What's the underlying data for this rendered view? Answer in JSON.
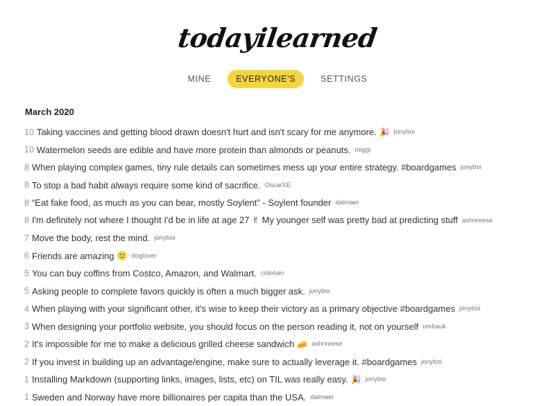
{
  "header": {
    "logo_text": "todayilearned"
  },
  "nav": {
    "tabs": [
      {
        "label": "MINE",
        "active": false
      },
      {
        "label": "EVERYONE'S",
        "active": true
      },
      {
        "label": "SETTINGS",
        "active": false
      }
    ]
  },
  "feed": {
    "month": "March 2020",
    "items": [
      {
        "count": "10",
        "text": "Taking vaccines and getting blood drawn doesn't hurt and isn't scary for me anymore.",
        "emoji": "🎉",
        "user": "jonyboi"
      },
      {
        "count": "10",
        "text": "Watermelon seeds are edible and have more protein than almonds or peanuts.",
        "emoji": "",
        "user": "miggi"
      },
      {
        "count": "8",
        "text": "When playing complex games, tiny rule details can sometimes mess up your entire strategy. #boardgames",
        "emoji": "",
        "user": "jonyboi"
      },
      {
        "count": "8",
        "text": "To stop a bad habit always require some kind of sacrifice.",
        "emoji": "",
        "user": "OscarSE"
      },
      {
        "count": "8",
        "text": "“Eat fake food, as much as you can bear, mostly Soylent” - Soylent founder",
        "emoji": "",
        "user": "dalmaer"
      },
      {
        "count": "8",
        "text": "I'm definitely not where I thought I'd be in life at age 27 ✌ My younger self was pretty bad at predicting stuff",
        "emoji": "",
        "user": "ashnreese"
      },
      {
        "count": "7",
        "text": "Move the body, rest the mind.",
        "emoji": "",
        "user": "jonyboi"
      },
      {
        "count": "6",
        "text": "Friends are amazing",
        "emoji": "🙂",
        "user": "doglover"
      },
      {
        "count": "5",
        "text": "You can buy coffins from Costco, Amazon, and Walmart.",
        "emoji": "",
        "user": "colohan"
      },
      {
        "count": "5",
        "text": "Asking people to complete favors quickly is often a much bigger ask.",
        "emoji": "",
        "user": "jonyboi"
      },
      {
        "count": "4",
        "text": "When playing with your significant other, it's wise to keep their victory as a primary objective #boardgames",
        "emoji": "",
        "user": "jonyboi"
      },
      {
        "count": "3",
        "text": "When designing your portfolio website, you should focus on the person reading it, not on yourself",
        "emoji": "",
        "user": "umbauk"
      },
      {
        "count": "2",
        "text": "It's impossible for me to make a delicious grilled cheese sandwich",
        "emoji": "🧀",
        "user": "ashnreese"
      },
      {
        "count": "2",
        "text": "If you invest in building up an advantage/engine, make sure to actually leverage it. #boardgames",
        "emoji": "",
        "user": "jonyboi"
      },
      {
        "count": "1",
        "text": "Installing Markdown (supporting links, images, lists, etc) on TIL was really easy.",
        "emoji": "🎉",
        "user": "jonyboi"
      },
      {
        "count": "1",
        "text": "Sweden and Norway have more billionaires per capita than the USA.",
        "emoji": "",
        "user": "dalmaer"
      }
    ]
  }
}
